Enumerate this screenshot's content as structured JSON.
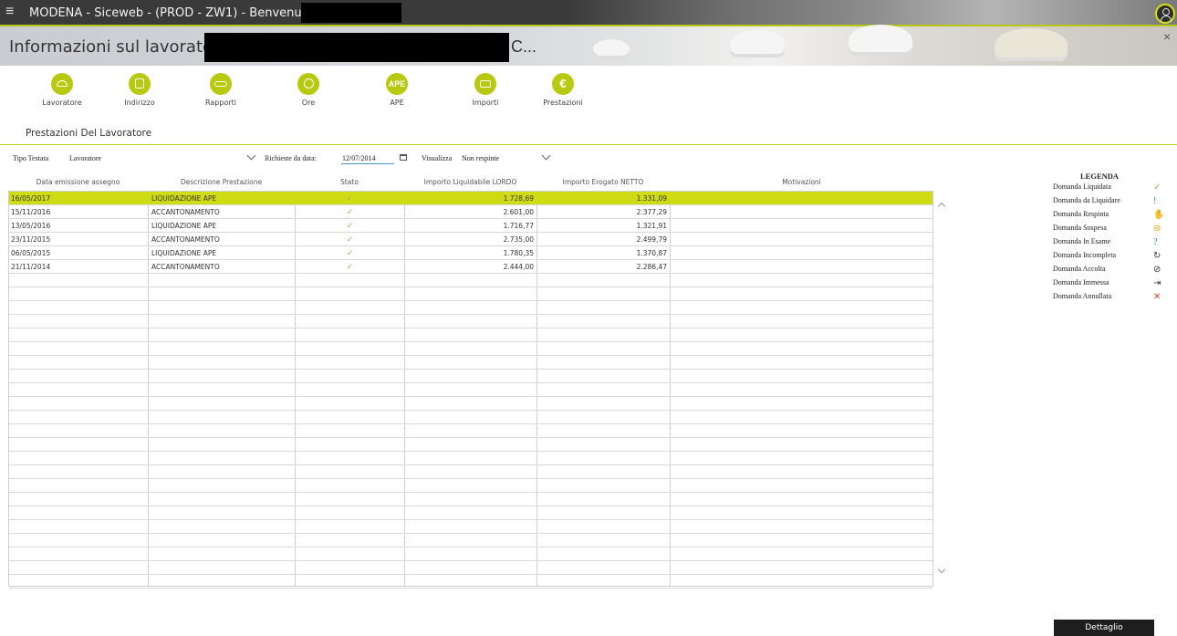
{
  "titlebar": {
    "title": "MODENA - Siceweb - (PROD - ZW1) - Benvenuto Utente",
    "menu_icon": "hamburger-icon",
    "user_icon": "user-icon"
  },
  "header": {
    "title": "Informazioni sul lavoratore:",
    "suffix": "C...",
    "close": "×"
  },
  "nav": [
    {
      "label": "Lavoratore",
      "icon": "helmet-icon",
      "text": ""
    },
    {
      "label": "Indirizzo",
      "icon": "address-card-icon",
      "text": ""
    },
    {
      "label": "Rapporti",
      "icon": "handshake-icon",
      "text": ""
    },
    {
      "label": "Ore",
      "icon": "clock-icon",
      "text": ""
    },
    {
      "label": "APE",
      "icon": "ape-icon",
      "text": "APE"
    },
    {
      "label": "Importi",
      "icon": "money-icon",
      "text": ""
    },
    {
      "label": "Prestazioni",
      "icon": "euro-icon",
      "text": "€"
    }
  ],
  "section_title": "Prestazioni Del Lavoratore",
  "filters": {
    "tipo_label": "Tipo Testata",
    "tipo_value": "Lavoratore",
    "richieste_label": "Richieste da data:",
    "date_value": "12/07/2014",
    "visualizza_label": "Visualizza",
    "visualizza_value": "Non respinte"
  },
  "table": {
    "columns": [
      "Data emissione assegno",
      "Descrizione Prestazione",
      "Stato",
      "Importo Liquidabile LORDO",
      "Importo Erogato NETTO",
      "Motivazioni"
    ],
    "rows": [
      {
        "data": "16/05/2017",
        "descr": "LIQUIDAZIONE APE",
        "stato": "✓",
        "lordo": "1.728,69",
        "netto": "1.331,09",
        "motiv": ""
      },
      {
        "data": "15/11/2016",
        "descr": "ACCANTONAMENTO",
        "stato": "✓",
        "lordo": "2.601,00",
        "netto": "2.377,29",
        "motiv": ""
      },
      {
        "data": "13/05/2016",
        "descr": "LIQUIDAZIONE APE",
        "stato": "✓",
        "lordo": "1.716,77",
        "netto": "1.321,91",
        "motiv": ""
      },
      {
        "data": "23/11/2015",
        "descr": "ACCANTONAMENTO",
        "stato": "✓",
        "lordo": "2.735,00",
        "netto": "2.499,79",
        "motiv": ""
      },
      {
        "data": "06/05/2015",
        "descr": "LIQUIDAZIONE APE",
        "stato": "✓",
        "lordo": "1.780,35",
        "netto": "1.370,87",
        "motiv": ""
      },
      {
        "data": "21/11/2014",
        "descr": "ACCANTONAMENTO",
        "stato": "✓",
        "lordo": "2.444,00",
        "netto": "2.286,47",
        "motiv": ""
      }
    ],
    "selected_row": 0
  },
  "legend": {
    "title": "LEGENDA",
    "items": [
      {
        "label": "Domanda Liquidata",
        "icon": "check-icon",
        "glyph": "✓",
        "color": "#8fbf5a"
      },
      {
        "label": "Domanda da Liquidare",
        "icon": "exclamation-icon",
        "glyph": "!",
        "color": "#2f7fd1"
      },
      {
        "label": "Domanda Respinta",
        "icon": "hand-icon",
        "glyph": "✋",
        "color": "#e0442e"
      },
      {
        "label": "Domanda Sospesa",
        "icon": "pause-icon",
        "glyph": "⊜",
        "color": "#e8a21a"
      },
      {
        "label": "Domanda In Esame",
        "icon": "question-icon",
        "glyph": "?",
        "color": "#2f7fd1"
      },
      {
        "label": "Domanda Incompleta",
        "icon": "refresh-icon",
        "glyph": "↻",
        "color": "#333333"
      },
      {
        "label": "Domanda Accolta",
        "icon": "circle-check-icon",
        "glyph": "⊘",
        "color": "#333333"
      },
      {
        "label": "Domanda Immessa",
        "icon": "enter-icon",
        "glyph": "⇥",
        "color": "#333333"
      },
      {
        "label": "Domanda Annullata",
        "icon": "cross-icon",
        "glyph": "✕",
        "color": "#e0442e"
      }
    ]
  },
  "buttons": {
    "dettaglio": "Dettaglio"
  },
  "colors": {
    "accent": "#cfdc14",
    "titlebar": "#3a3a3a"
  }
}
